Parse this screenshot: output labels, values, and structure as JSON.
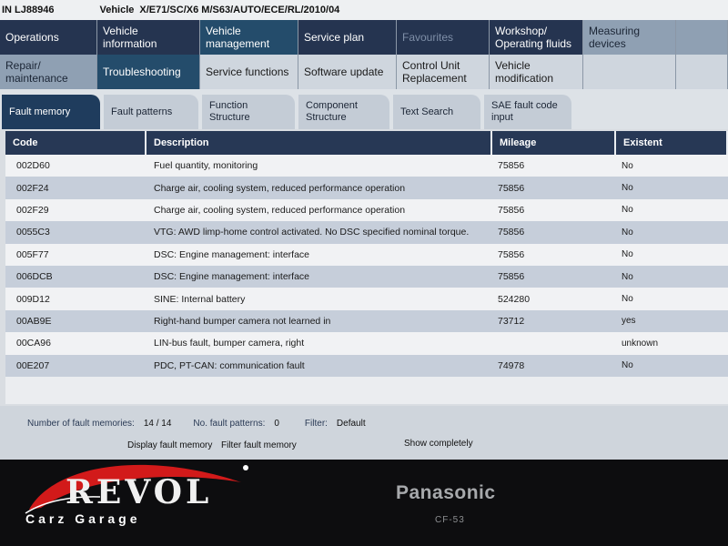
{
  "vin_bar": {
    "vin": "IN LJ88946",
    "vehicle_label": "Vehicle",
    "vehicle_value": "X/E71/SC/X6 M/S63/AUTO/ECE/RL/2010/04"
  },
  "nav_row1": [
    {
      "label": "Operations"
    },
    {
      "label": "Vehicle information"
    },
    {
      "label": "Vehicle management"
    },
    {
      "label": "Service plan"
    },
    {
      "label": "Favourites"
    },
    {
      "label": "Workshop/ Operating fluids"
    },
    {
      "label": "Measuring devices"
    }
  ],
  "nav_row2": [
    {
      "label": "Repair/ maintenance"
    },
    {
      "label": "Troubleshooting"
    },
    {
      "label": "Service functions"
    },
    {
      "label": "Software update"
    },
    {
      "label": "Control Unit Replacement"
    },
    {
      "label": "Vehicle modification"
    }
  ],
  "subtabs": [
    {
      "label": "Fault memory"
    },
    {
      "label": "Fault patterns"
    },
    {
      "label": "Function Structure"
    },
    {
      "label": "Component Structure"
    },
    {
      "label": "Text Search"
    },
    {
      "label": "SAE fault code input"
    }
  ],
  "table": {
    "headers": [
      "Code",
      "Description",
      "Mileage",
      "Existent"
    ],
    "rows": [
      {
        "code": "002D60",
        "description": "Fuel quantity, monitoring",
        "mileage": "75856",
        "existent": "No"
      },
      {
        "code": "002F24",
        "description": "Charge air, cooling system, reduced performance operation",
        "mileage": "75856",
        "existent": "No"
      },
      {
        "code": "002F29",
        "description": "Charge air, cooling system, reduced performance operation",
        "mileage": "75856",
        "existent": "No"
      },
      {
        "code": "0055C3",
        "description": "VTG: AWD limp-home control activated. No DSC specified nominal torque.",
        "mileage": "75856",
        "existent": "No"
      },
      {
        "code": "005F77",
        "description": "DSC: Engine management: interface",
        "mileage": "75856",
        "existent": "No"
      },
      {
        "code": "006DCB",
        "description": "DSC: Engine management: interface",
        "mileage": "75856",
        "existent": "No"
      },
      {
        "code": "009D12",
        "description": "SINE: Internal battery",
        "mileage": "524280",
        "existent": "No"
      },
      {
        "code": "00AB9E",
        "description": "Right-hand bumper camera not learned in",
        "mileage": "73712",
        "existent": "yes"
      },
      {
        "code": "00CA96",
        "description": "LIN-bus fault, bumper camera, right",
        "mileage": "",
        "existent": "unknown"
      },
      {
        "code": "00E207",
        "description": "PDC, PT-CAN: communication fault",
        "mileage": "74978",
        "existent": "No"
      }
    ]
  },
  "footer": {
    "fault_memories_label": "Number of fault memories:",
    "fault_memories_value": "14 / 14",
    "fault_patterns_label": "No. fault patterns:",
    "fault_patterns_value": "0",
    "filter_label": "Filter:",
    "filter_value": "Default",
    "btn_display": "Display fault memory",
    "btn_filter": "Filter fault memory",
    "btn_show": "Show completely"
  },
  "bezel": {
    "brand": "Panasonic",
    "model": "CF-53"
  },
  "watermark": {
    "title": "REVOL",
    "subtitle": "Carz Garage"
  },
  "colors": {
    "nav_dark": "#253450",
    "nav_teal": "#244c6b",
    "row_alt": "#c6ceda",
    "header": "#273855",
    "logo_red": "#d21a1a"
  }
}
